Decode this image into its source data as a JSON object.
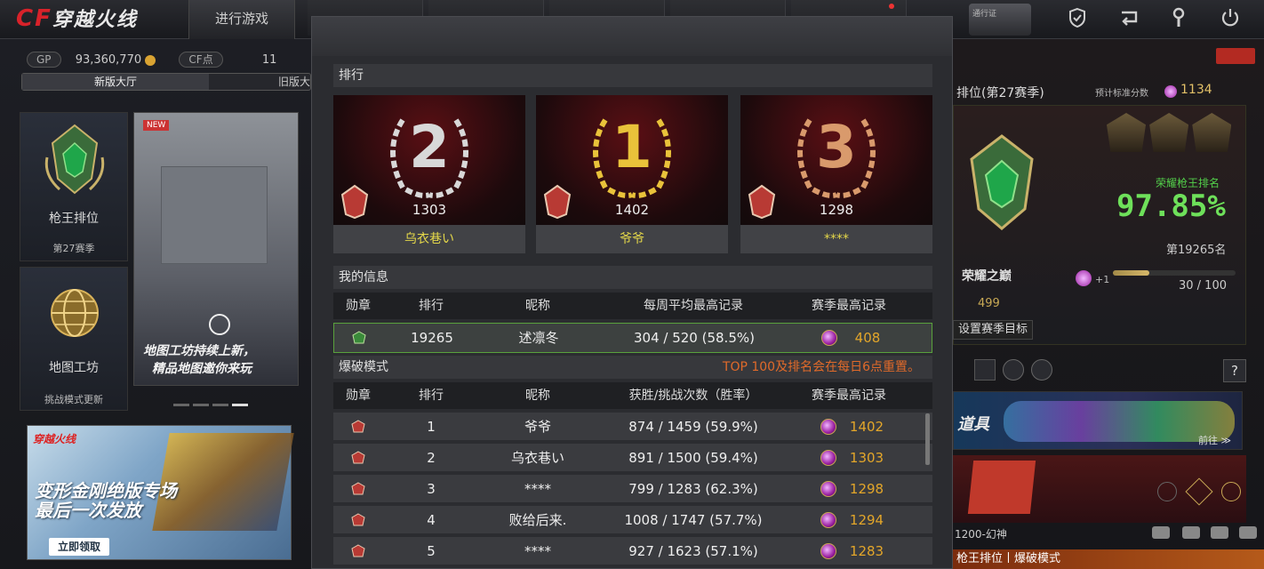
{
  "topbar": {
    "logo_text": "穿越火线",
    "play_button": "进行游戏",
    "icons": [
      "shield-icon",
      "return-icon",
      "wrench-icon",
      "power-icon"
    ],
    "pass_badge": "通行证"
  },
  "left": {
    "gp_label": "GP",
    "gp_value": "93,360,770",
    "cf_label": "CF点",
    "cf_value": "11",
    "hall_new": "新版大厅",
    "hall_old": "旧版大",
    "rank_card_title": "枪王排位",
    "rank_card_sub": "第27赛季",
    "map_card_title": "地图工坊",
    "map_card_sub": "挑战模式更新",
    "banner_text_1": "地图工坊持续上新，",
    "banner_text_2": "精品地图邀你来玩",
    "banner2_logo": "穿越火线",
    "banner2_title": "变形金刚绝版专场 最后一次发放",
    "banner2_btn": "立即领取"
  },
  "right": {
    "title": "排位(第27赛季)",
    "score_label": "预计标准分数",
    "score_value": "1134",
    "rank_label": "荣耀枪王排名",
    "percent": "97.85%",
    "rank_position": "第19265名",
    "tier_name": "荣耀之巅",
    "tier_points": "499",
    "plus": "+1",
    "progress_text": "30 / 100",
    "progress_fraction": 0.3,
    "goal_button": "设置赛季目标",
    "help": "?",
    "item_label": "道具",
    "item_more": "前往 ≫",
    "bottom_text": "1200-幻神",
    "bottom_bar": "枪王排位丨爆破模式"
  },
  "modal": {
    "ranking_title": "排行",
    "podium": [
      {
        "rank": "2",
        "score": "1303",
        "name": "乌衣巷い",
        "color": "#d8d8d8"
      },
      {
        "rank": "1",
        "score": "1402",
        "name": "爷爷",
        "color": "#e9c23a"
      },
      {
        "rank": "3",
        "score": "1298",
        "name": "****",
        "color": "#d99a6c"
      }
    ],
    "my_info_title": "我的信息",
    "my_headers": [
      "勋章",
      "排行",
      "昵称",
      "每周平均最高记录",
      "赛季最高记录"
    ],
    "my_row": {
      "rank": "19265",
      "name": "述凛冬",
      "weekly": "304 / 520 (58.5%)",
      "season": "408"
    },
    "mode_title": "爆破模式",
    "notice": "TOP 100及排名会在每日6点重置。",
    "mode_headers": [
      "勋章",
      "排行",
      "昵称",
      "获胜/挑战次数（胜率）",
      "赛季最高记录"
    ],
    "rows": [
      {
        "rank": "1",
        "name": "爷爷",
        "record": "874 / 1459 (59.9%)",
        "season": "1402"
      },
      {
        "rank": "2",
        "name": "乌衣巷い",
        "record": "891 / 1500 (59.4%)",
        "season": "1303"
      },
      {
        "rank": "3",
        "name": "****",
        "record": "799 / 1283 (62.3%)",
        "season": "1298"
      },
      {
        "rank": "4",
        "name": "败给后来.",
        "record": "1008 / 1747 (57.7%)",
        "season": "1294"
      },
      {
        "rank": "5",
        "name": "****",
        "record": "927 / 1623 (57.1%)",
        "season": "1283"
      }
    ]
  }
}
